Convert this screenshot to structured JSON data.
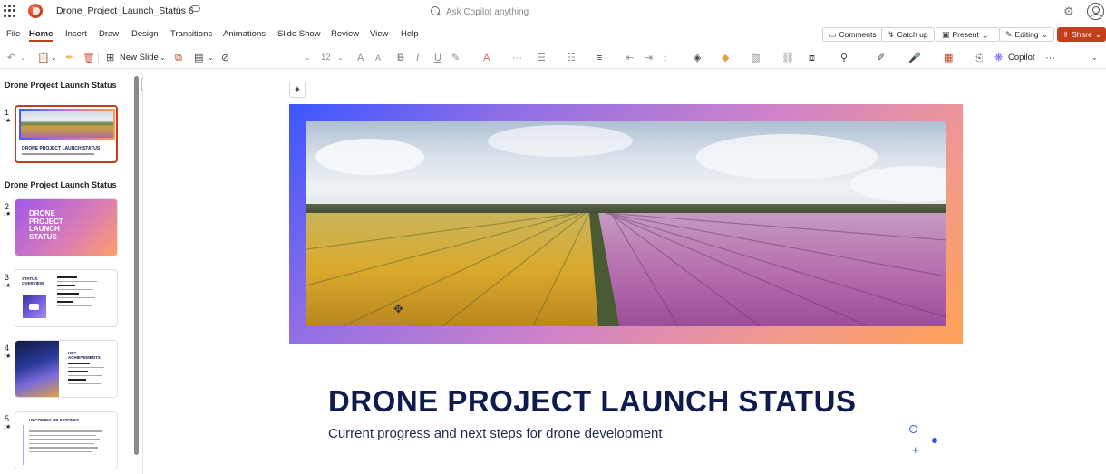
{
  "titlebar": {
    "doc_title": "Drone_Project_Launch_Status 6",
    "search_placeholder": "Ask Copilot anything"
  },
  "menu": {
    "items": [
      "File",
      "Home",
      "Insert",
      "Draw",
      "Design",
      "Transitions",
      "Animations",
      "Slide Show",
      "Review",
      "View",
      "Help"
    ],
    "active": "Home"
  },
  "ribbon_buttons": {
    "comments": "Comments",
    "catch_up": "Catch up",
    "present": "Present",
    "editing": "Editing",
    "share": "Share"
  },
  "toolbar": {
    "new_slide": "New Slide",
    "font_size": "12",
    "copilot": "Copilot"
  },
  "slides_panel": {
    "section_1": "Drone Project Launch Status",
    "section_2": "Drone Project Launch Status",
    "slides": [
      {
        "number": "1",
        "title": "DRONE PROJECT LAUNCH STATUS"
      },
      {
        "number": "2",
        "title": "DRONE PROJECT LAUNCH STATUS"
      },
      {
        "number": "3",
        "title": "STATUS OVERVIEW"
      },
      {
        "number": "4",
        "title": "KEY ACHIEVEMENTS"
      },
      {
        "number": "5",
        "title": "UPCOMING MILESTONES"
      }
    ]
  },
  "slide": {
    "title": "DRONE PROJECT LAUNCH STATUS",
    "subtitle": "Current progress and next steps for drone development"
  },
  "colors": {
    "accent": "#c43e1c",
    "title_navy": "#0f1b4c",
    "frame_start": "#3a56ff",
    "frame_end": "#ffa255"
  }
}
